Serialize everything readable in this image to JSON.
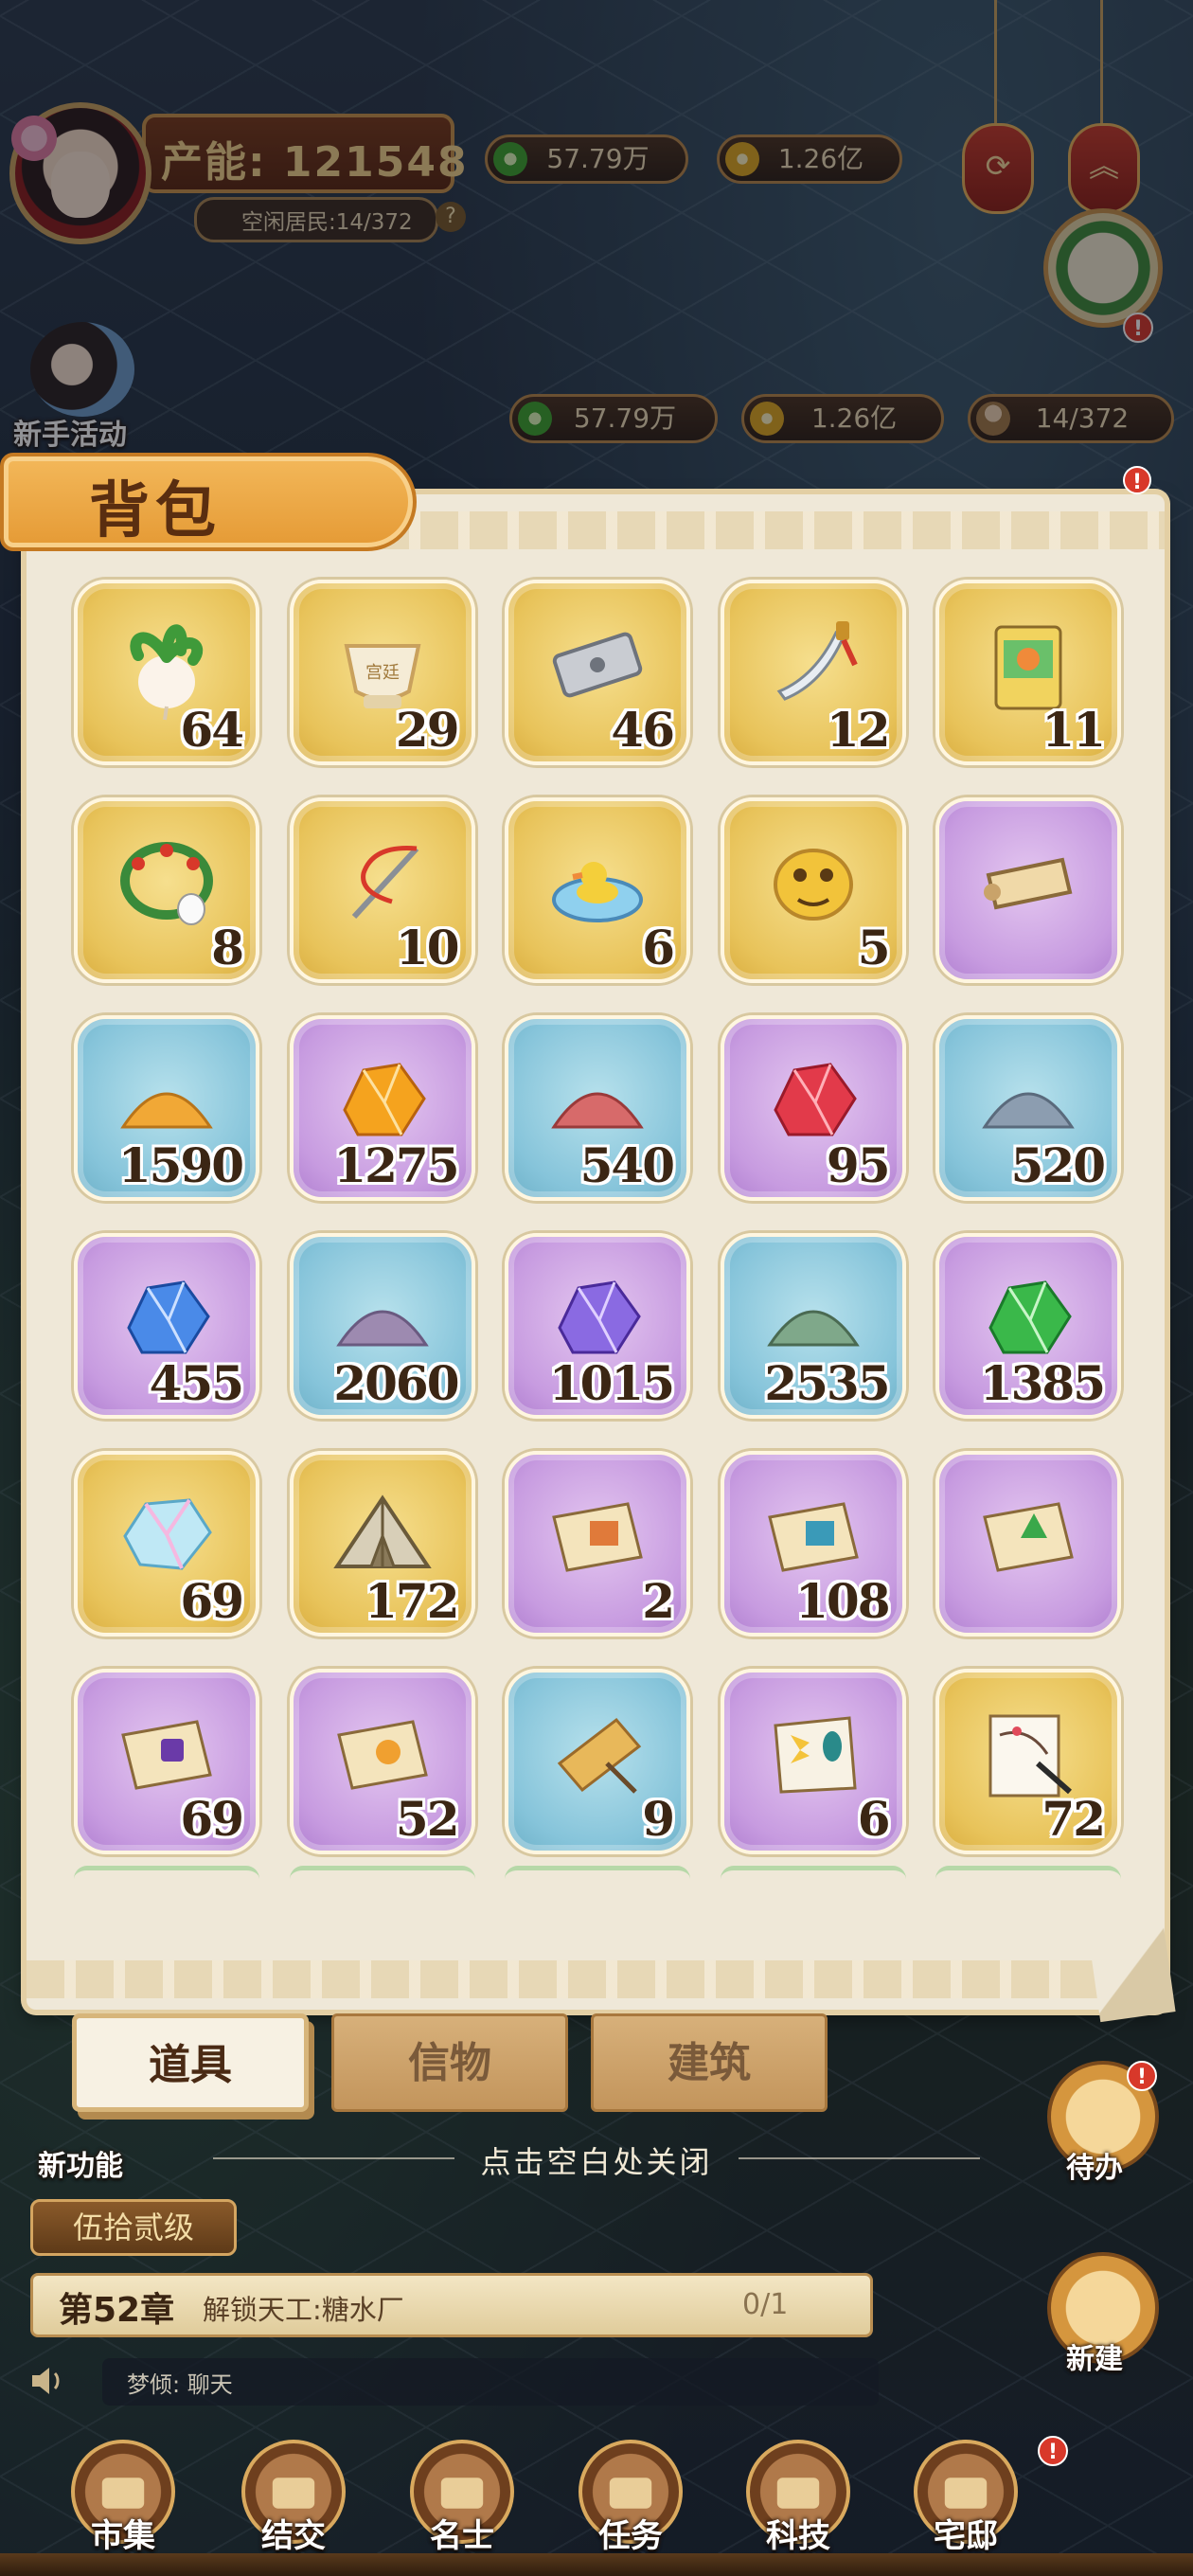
{
  "hud": {
    "production_label": "产能: 121548",
    "idle_residents": "空闲居民:14/372",
    "help_mark": "?",
    "copper_top": "57.79万",
    "gold_top": "1.26亿"
  },
  "resources": {
    "copper": "57.79万",
    "gold": "1.26亿",
    "residents": "14/372"
  },
  "side": {
    "newbie_event": "新手活动",
    "new_feature": "新功能",
    "todo": "待办",
    "build_new": "新建",
    "alert": "!"
  },
  "panel": {
    "title": "背包",
    "items": [
      {
        "icon": "turnip-icon",
        "count": "64",
        "bg": "gold"
      },
      {
        "icon": "palace-cup-icon",
        "count": "29",
        "bg": "gold",
        "art_text": "宫廷"
      },
      {
        "icon": "razor-blade-icon",
        "count": "46",
        "bg": "gold"
      },
      {
        "icon": "dagger-icon",
        "count": "12",
        "bg": "gold"
      },
      {
        "icon": "storybook-icon",
        "count": "11",
        "bg": "gold"
      },
      {
        "icon": "flower-wreath-bird-icon",
        "count": "8",
        "bg": "gold"
      },
      {
        "icon": "needle-thread-icon",
        "count": "10",
        "bg": "gold"
      },
      {
        "icon": "duck-basin-icon",
        "count": "6",
        "bg": "gold"
      },
      {
        "icon": "golden-toad-icon",
        "count": "5",
        "bg": "gold"
      },
      {
        "icon": "scroll-map-icon",
        "count": "",
        "bg": "purple"
      },
      {
        "icon": "orange-sand-icon",
        "count": "1590",
        "bg": "blue"
      },
      {
        "icon": "orange-crystal-icon",
        "count": "1275",
        "bg": "purple"
      },
      {
        "icon": "red-sand-icon",
        "count": "540",
        "bg": "blue"
      },
      {
        "icon": "red-crystal-icon",
        "count": "95",
        "bg": "purple"
      },
      {
        "icon": "grey-blue-sand-icon",
        "count": "520",
        "bg": "blue"
      },
      {
        "icon": "blue-crystal-icon",
        "count": "455",
        "bg": "purple"
      },
      {
        "icon": "violet-sand-icon",
        "count": "2060",
        "bg": "blue"
      },
      {
        "icon": "violet-crystal-icon",
        "count": "1015",
        "bg": "purple"
      },
      {
        "icon": "green-sand-icon",
        "count": "2535",
        "bg": "blue"
      },
      {
        "icon": "green-crystal-icon",
        "count": "1385",
        "bg": "purple"
      },
      {
        "icon": "rainbow-gem-icon",
        "count": "69",
        "bg": "gold"
      },
      {
        "icon": "tent-icon",
        "count": "172",
        "bg": "gold"
      },
      {
        "icon": "blueprint-shop-icon",
        "count": "2",
        "bg": "purple"
      },
      {
        "icon": "blueprint-blue-icon",
        "count": "108",
        "bg": "purple"
      },
      {
        "icon": "blueprint-tree-icon",
        "count": "",
        "bg": "purple"
      },
      {
        "icon": "blueprint-dice-icon",
        "count": "69",
        "bg": "purple"
      },
      {
        "icon": "blueprint-orange-icon",
        "count": "52",
        "bg": "purple"
      },
      {
        "icon": "bamboo-mat-icon",
        "count": "9",
        "bg": "blue"
      },
      {
        "icon": "butterfly-peacock-icon",
        "count": "6",
        "bg": "purple"
      },
      {
        "icon": "painting-brush-icon",
        "count": "72",
        "bg": "gold"
      }
    ]
  },
  "tabs": [
    {
      "label": "道具",
      "active": true
    },
    {
      "label": "信物",
      "active": false
    },
    {
      "label": "建筑",
      "active": false
    }
  ],
  "close_hint": "点击空白处关闭",
  "level": "伍拾贰级",
  "chapter": {
    "number": "第52章",
    "task": "解锁天工:糖水厂",
    "progress": "0/1"
  },
  "chat": "梦倾: 聊天",
  "nav": [
    {
      "label": "市集",
      "icon": "market-icon"
    },
    {
      "label": "结交",
      "icon": "cards-icon"
    },
    {
      "label": "名士",
      "icon": "scholar-icon"
    },
    {
      "label": "任务",
      "icon": "task-icon"
    },
    {
      "label": "科技",
      "icon": "tech-icon"
    },
    {
      "label": "宅邸",
      "icon": "mansion-icon"
    }
  ],
  "colors": {
    "slot_gold": "#e8c35a",
    "slot_purple": "#c79be0",
    "slot_blue": "#86c4da",
    "count_text": "#3b2614",
    "title_ribbon": "#e59a35",
    "alert_red": "#d8382a"
  }
}
